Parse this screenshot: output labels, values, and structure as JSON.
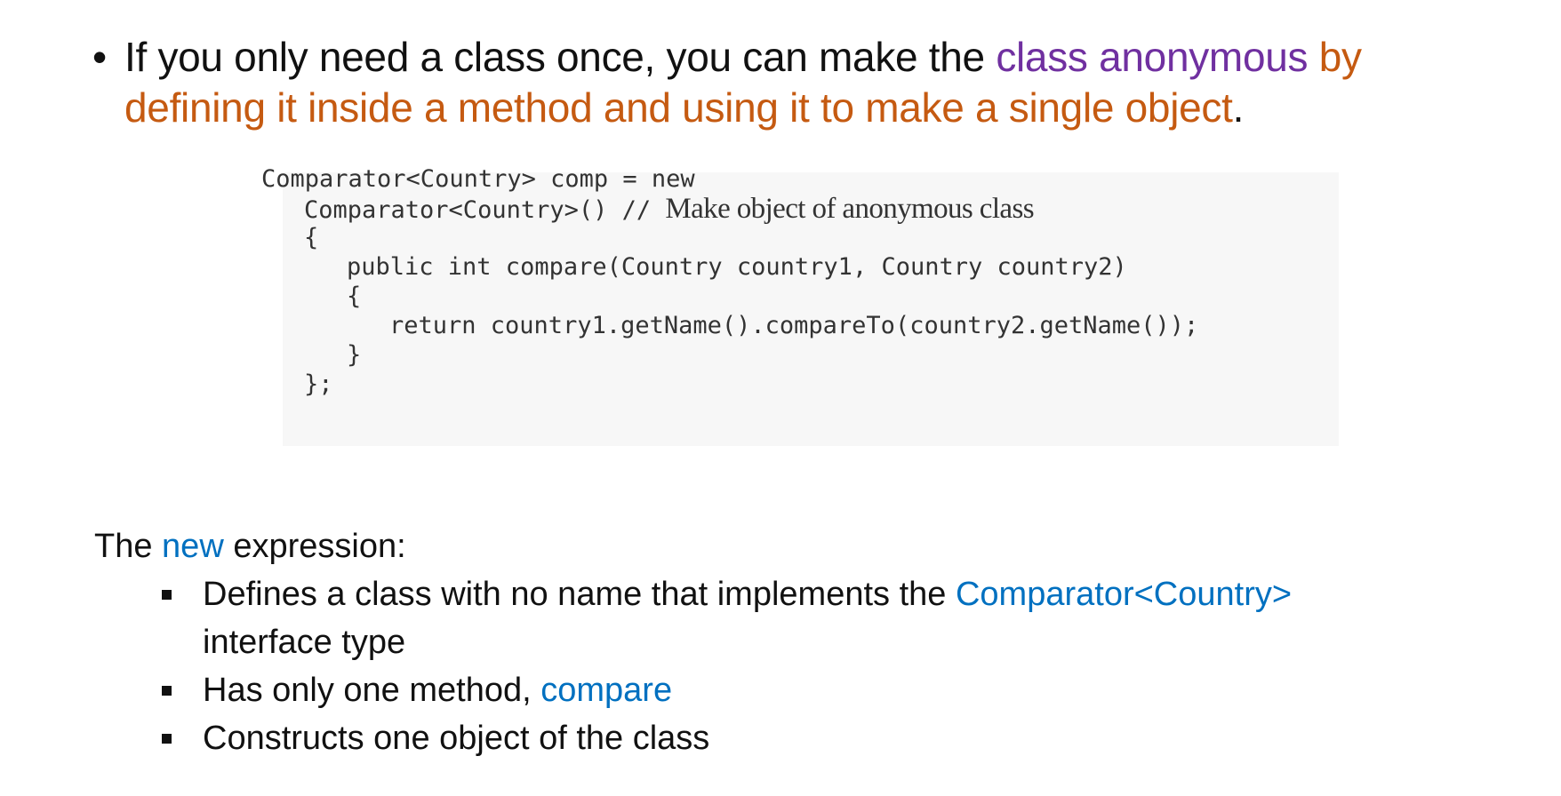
{
  "bullet_main": {
    "dot": "•",
    "part1": "If you only need a class once, you can make the ",
    "part2": "class anonymous",
    "part3": " by defining it inside a method and using it to make a single object",
    "part4": "."
  },
  "code": {
    "line1": "Comparator<Country> comp = new",
    "line2_code": "Comparator<Country>() // ",
    "line2_comment": "Make object of anonymous class",
    "line3": "{",
    "line4": "public int compare(Country country1, Country country2)",
    "line5": "{",
    "line6": "return country1.getName().compareTo(country2.getName());",
    "line7": "}",
    "line8": "};"
  },
  "intro": {
    "before": "The ",
    "keyword": "new",
    "after": " expression:"
  },
  "sub_items": {
    "item1_before": "Defines a class with no name that implements the ",
    "item1_highlight": "Comparator<Country>",
    "item1_after": " interface type",
    "item2_before": "Has only one method, ",
    "item2_highlight": "compare",
    "item3": "Constructs one object of the class"
  },
  "colors": {
    "purple": "#7030a0",
    "orange": "#c55a11",
    "blue": "#0070c0"
  }
}
